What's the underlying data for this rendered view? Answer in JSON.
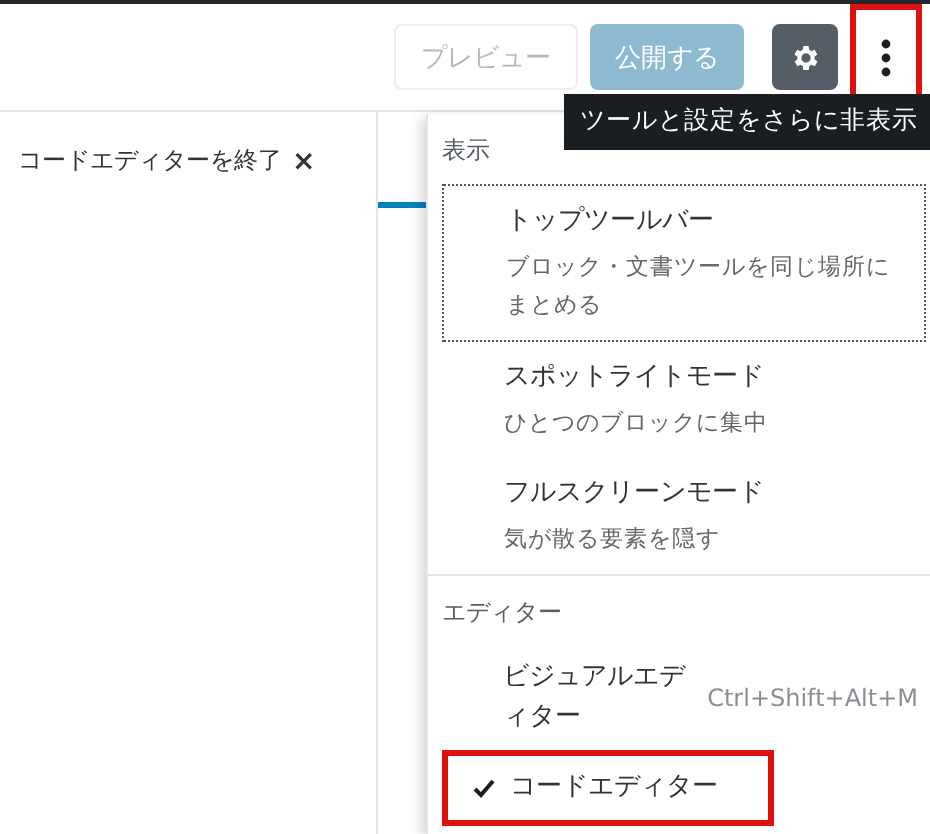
{
  "toolbar": {
    "buttons": [
      {
        "kind": "text",
        "label": "プレビュー",
        "disabled": true
      },
      {
        "kind": "primary",
        "label": "公開する",
        "disabled": true
      },
      {
        "kind": "settings",
        "pressed": true
      },
      {
        "kind": "more",
        "highlighted": true
      }
    ],
    "tooltip": "ツールと設定をさらに非表示"
  },
  "exit_code_editor": {
    "label": "コードエディターを終了",
    "close": "×"
  },
  "menu": {
    "sections": [
      {
        "heading": "表示",
        "items": [
          {
            "title": "トップツールバー",
            "description": "ブロック・文書ツールを同じ場所にまとめる",
            "focused": true
          },
          {
            "title": "スポットライトモード",
            "description": "ひとつのブロックに集中",
            "focused": false
          },
          {
            "title": "フルスクリーンモード",
            "description": "気が散る要素を隠す",
            "focused": false
          }
        ]
      },
      {
        "heading": "エディター",
        "items": [
          {
            "title": "ビジュアルエディター",
            "shortcut": "Ctrl+Shift+Alt+M",
            "checked": false,
            "highlighted": false
          },
          {
            "title": "コードエディター",
            "checked": true,
            "highlighted": true
          }
        ]
      }
    ]
  }
}
